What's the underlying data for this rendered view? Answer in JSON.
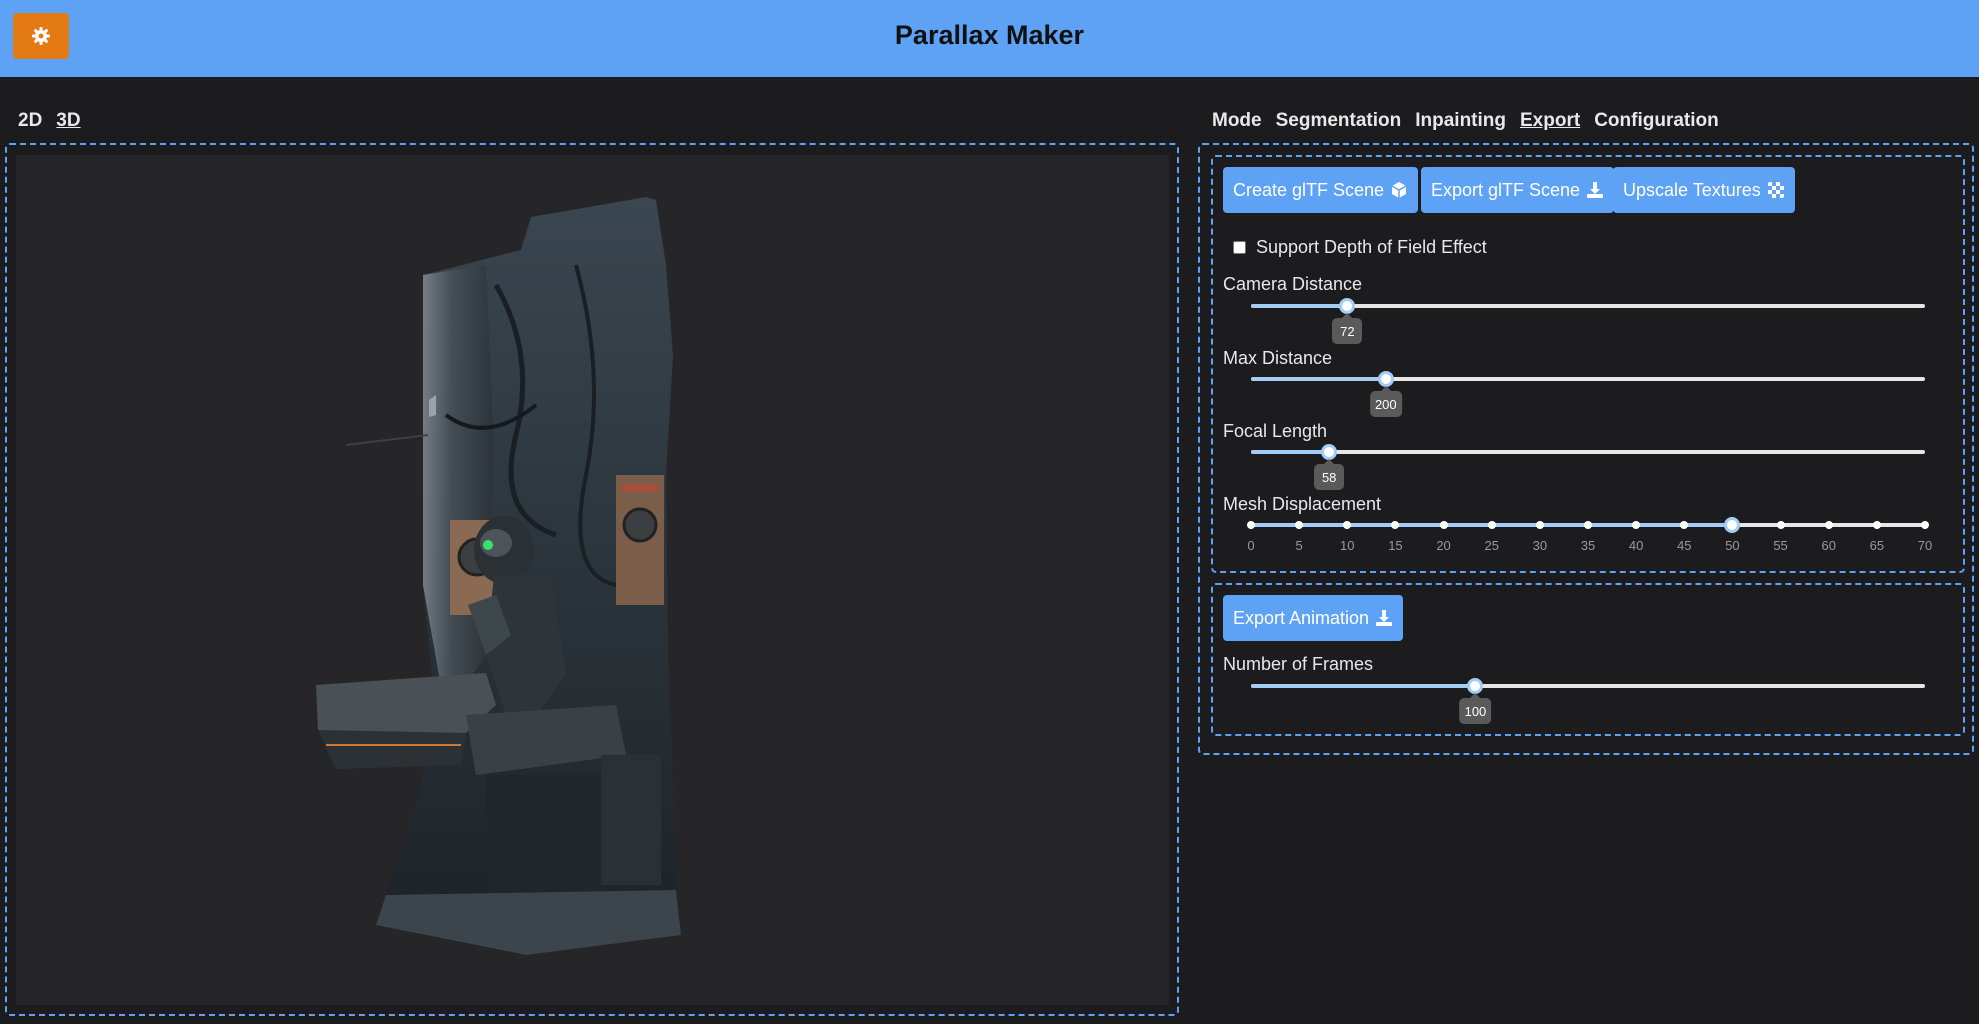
{
  "header": {
    "title": "Parallax Maker",
    "settings_icon": "gear-icon",
    "accent": "#5ea2f6",
    "settings_color": "#e37a14"
  },
  "view_tabs": [
    {
      "label": "2D"
    },
    {
      "label": "3D",
      "active": true
    }
  ],
  "main_tabs": [
    {
      "label": "Mode"
    },
    {
      "label": "Segmentation"
    },
    {
      "label": "Inpainting"
    },
    {
      "label": "Export",
      "active": true
    },
    {
      "label": "Configuration"
    }
  ],
  "export": {
    "buttons": {
      "create_gltf": "Create glTF Scene",
      "export_gltf": "Export glTF Scene",
      "upscale": "Upscale Textures"
    },
    "dof_checkbox": {
      "label": "Support Depth of Field Effect",
      "checked": false
    },
    "sliders": {
      "camera_distance": {
        "label": "Camera Distance",
        "value": "72",
        "fraction": 0.143
      },
      "max_distance": {
        "label": "Max Distance",
        "value": "200",
        "fraction": 0.2
      },
      "focal_length": {
        "label": "Focal Length",
        "value": "58",
        "fraction": 0.116
      }
    },
    "mesh_displacement": {
      "label": "Mesh Displacement",
      "value": 50,
      "min": 0,
      "max": 70,
      "ticks": [
        "0",
        "5",
        "10",
        "15",
        "20",
        "25",
        "30",
        "35",
        "40",
        "45",
        "50",
        "55",
        "60",
        "65",
        "70"
      ]
    }
  },
  "animation": {
    "export_button": "Export Animation",
    "frames": {
      "label": "Number of Frames",
      "value": "100",
      "fraction": 0.333
    }
  }
}
